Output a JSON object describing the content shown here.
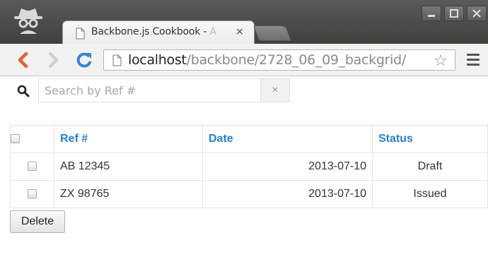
{
  "browser": {
    "tab": {
      "title_main": "Backbone.js Cookbook - ",
      "title_fade": "A",
      "close": "×"
    },
    "url": {
      "host": "localhost",
      "path": "/backbone/2728_06_09_backgrid/"
    },
    "star": "☆"
  },
  "search": {
    "placeholder": "Search by Ref #",
    "value": "",
    "clear": "×"
  },
  "grid": {
    "headers": {
      "ref": "Ref #",
      "date": "Date",
      "status": "Status"
    },
    "rows": [
      {
        "ref": "AB 12345",
        "date": "2013-07-10",
        "status": "Draft"
      },
      {
        "ref": "ZX 98765",
        "date": "2013-07-10",
        "status": "Issued"
      }
    ],
    "accent_color": "#2a7fd1"
  },
  "actions": {
    "delete_label": "Delete"
  },
  "icons": {
    "incognito": "incognito-icon",
    "back": "back-arrow-icon",
    "forward": "forward-arrow-icon",
    "reload": "reload-icon",
    "search": "search-icon",
    "menu": "hamburger-menu-icon"
  }
}
